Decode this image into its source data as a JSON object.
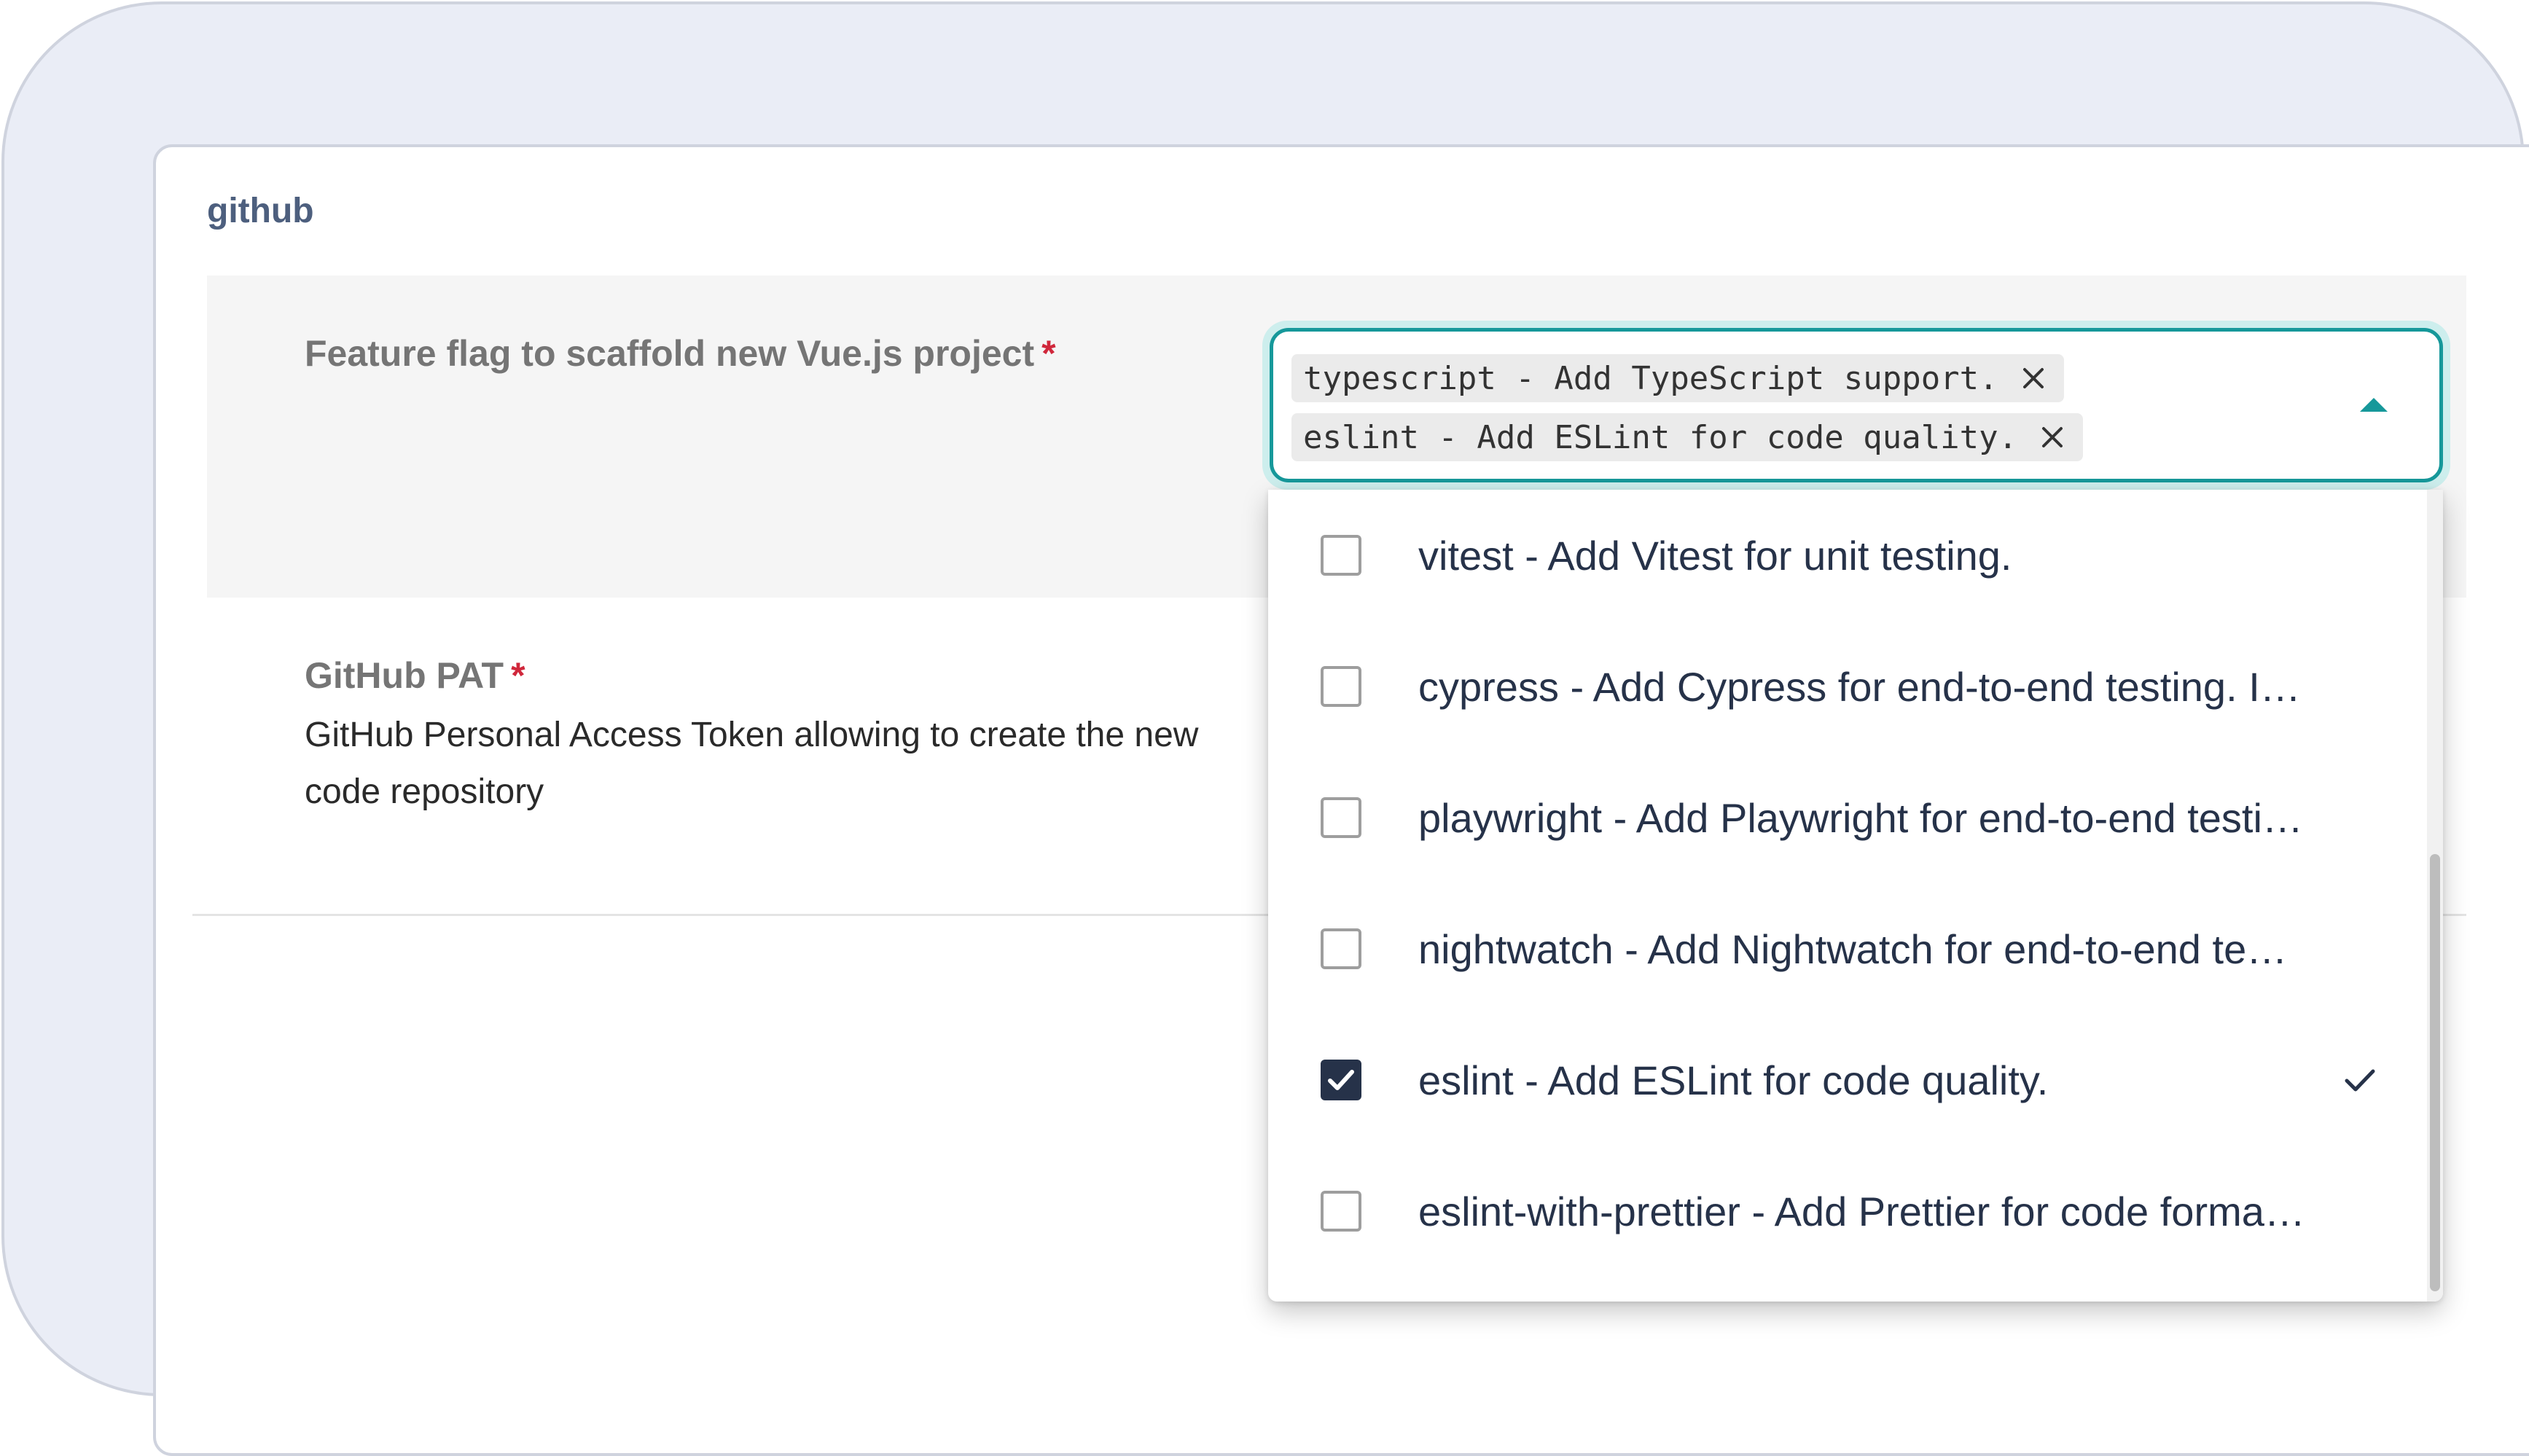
{
  "section": {
    "title": "github"
  },
  "fields": {
    "feature_flag": {
      "label": "Feature flag to scaffold new Vue.js project",
      "required_mark": "*"
    },
    "github_pat": {
      "label": "GitHub PAT",
      "required_mark": "*",
      "description": "GitHub Personal Access Token allowing to create the new code repository"
    }
  },
  "select": {
    "chips": [
      {
        "label": "typescript - Add TypeScript support.",
        "remove_icon": "close-icon"
      },
      {
        "label": "eslint - Add ESLint for code quality.",
        "remove_icon": "close-icon"
      }
    ],
    "toggle_icon": "caret-up-icon",
    "accent_color": "#16989a"
  },
  "dropdown": {
    "options": [
      {
        "label": "vitest - Add Vitest for unit testing.",
        "checked": false
      },
      {
        "label": "cypress - Add Cypress for end-to-end testing. If used without vitest, it will also add Cypress Component Testing.",
        "checked": false
      },
      {
        "label": "playwright - Add Playwright for end-to-end testing.",
        "checked": false
      },
      {
        "label": "nightwatch - Add Nightwatch for end-to-end testing.",
        "checked": false
      },
      {
        "label": "eslint - Add ESLint for code quality.",
        "checked": true
      },
      {
        "label": "eslint-with-prettier - Add Prettier for code formatting in addition to ESLint.",
        "checked": false
      }
    ]
  },
  "colors": {
    "checked_box": "#263249",
    "required": "#d0273b",
    "section_title": "#4d5f7e"
  }
}
